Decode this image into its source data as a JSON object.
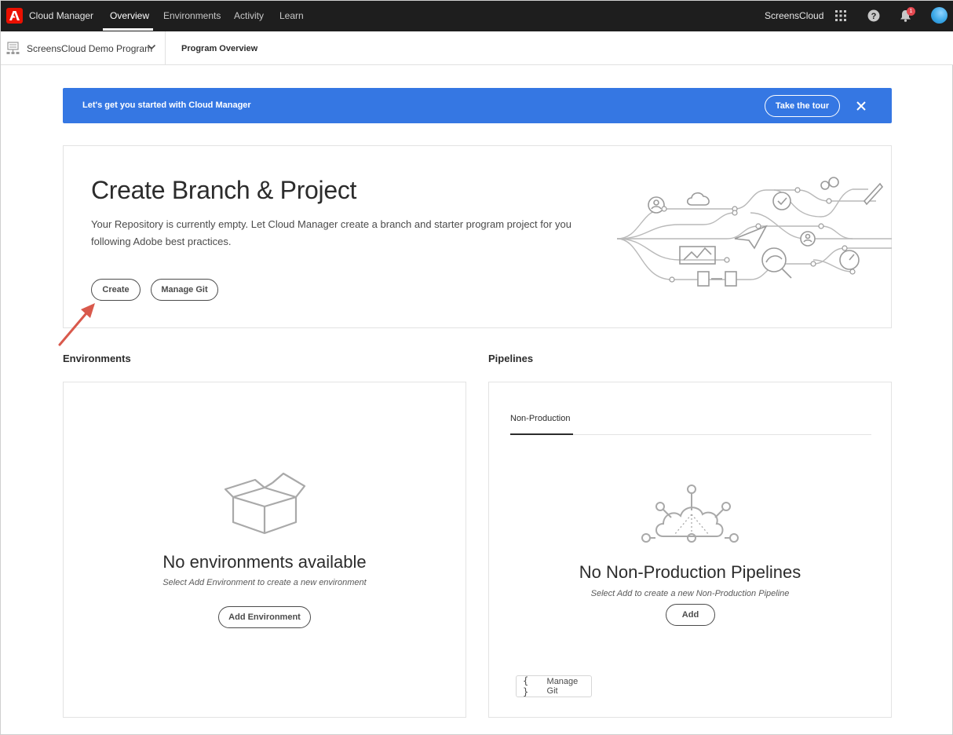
{
  "topbar": {
    "app_name": "Cloud Manager",
    "nav": [
      "Overview",
      "Environments",
      "Activity",
      "Learn"
    ],
    "active_nav": "Overview",
    "org_name": "ScreensCloud",
    "notification_count": "1",
    "icons": [
      "adobe-logo",
      "apps-grid-icon",
      "help-icon",
      "bell-icon",
      "avatar"
    ]
  },
  "subbar": {
    "program_name": "ScreensCloud Demo Program",
    "page_title": "Program Overview"
  },
  "banner": {
    "text": "Let's get you started with Cloud Manager",
    "tour_label": "Take the tour",
    "color": "#3577e3"
  },
  "branch_card": {
    "title": "Create Branch & Project",
    "description": "Your Repository is currently empty. Let Cloud Manager create a branch and starter program project for you following Adobe best practices.",
    "create_label": "Create",
    "manage_git_label": "Manage Git"
  },
  "environments": {
    "section_title": "Environments",
    "empty_title": "No environments available",
    "empty_sub": "Select Add Environment to create a new environment",
    "add_label": "Add Environment"
  },
  "pipelines": {
    "section_title": "Pipelines",
    "tab": "Non-Production",
    "empty_title": "No Non-Production Pipelines",
    "empty_sub": "Select Add to create a new Non-Production Pipeline",
    "add_label": "Add",
    "manage_git_label": "Manage Git"
  },
  "annotation_arrow_color": "#d9594c"
}
